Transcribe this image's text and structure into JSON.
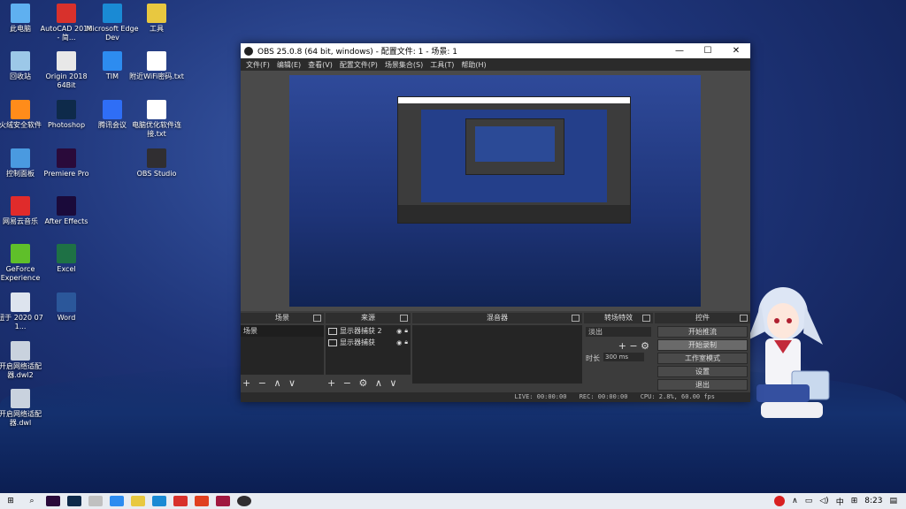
{
  "desktop": {
    "icons": [
      {
        "label": "此电脑",
        "color": "#5fb0f0"
      },
      {
        "label": "回收站",
        "color": "#9cc8e8"
      },
      {
        "label": "火绒安全软件",
        "color": "#ff8c1a"
      },
      {
        "label": "控制面板",
        "color": "#4a9ae0"
      },
      {
        "label": "网易云音乐",
        "color": "#e02b2b"
      },
      {
        "label": "GeForce Experience",
        "color": "#5fbf2a"
      },
      {
        "label": "纽于 2020 07 1...",
        "color": "#dde4ee"
      },
      {
        "label": "开启网络适配器.dwl2",
        "color": "#c9d2de"
      },
      {
        "label": "开启网络适配器.dwl",
        "color": "#c9d2de"
      },
      {
        "label": "AutoCAD 2016 - 简...",
        "color": "#d8312c"
      },
      {
        "label": "Origin 2018 64Bit",
        "color": "#e8e8e8"
      },
      {
        "label": "Photoshop",
        "color": "#0e2a4a"
      },
      {
        "label": "Premiere Pro",
        "color": "#2a0a3a"
      },
      {
        "label": "After Effects",
        "color": "#1a0a3a"
      },
      {
        "label": "Excel",
        "color": "#1e7145"
      },
      {
        "label": "Word",
        "color": "#2b579a"
      },
      {
        "label": "Microsoft Edge Dev",
        "color": "#1a8ad4"
      },
      {
        "label": "TIM",
        "color": "#2d8cf0"
      },
      {
        "label": "腾讯会议",
        "color": "#2f6ef6"
      },
      {
        "label": "工具",
        "color": "#e8c840"
      },
      {
        "label": "附近WiFi密码.txt",
        "color": "#ffffff"
      },
      {
        "label": "电脑优化软件连接.txt",
        "color": "#ffffff"
      },
      {
        "label": "OBS Studio",
        "color": "#302e31"
      }
    ]
  },
  "obs": {
    "title": "OBS 25.0.8 (64 bit, windows) - 配置文件: 1 - 场景: 1",
    "window_buttons": [
      "—",
      "☐",
      "✕"
    ],
    "menu": [
      "文件(F)",
      "编辑(E)",
      "查看(V)",
      "配置文件(P)",
      "场景集合(S)",
      "工具(T)",
      "帮助(H)"
    ],
    "docks": {
      "scenes": {
        "title": "场景",
        "items": [
          "场景"
        ]
      },
      "sources": {
        "title": "来源",
        "items": [
          "显示器捕获 2",
          "显示器捕获"
        ]
      },
      "mixer": {
        "title": "混音器"
      },
      "transitions": {
        "title": "转场特效",
        "select": "淡出",
        "duration_label": "时长",
        "duration_value": "300 ms"
      },
      "controls": {
        "title": "控件",
        "buttons": [
          "开始推流",
          "开始录制",
          "工作室模式",
          "设置",
          "退出"
        ]
      }
    },
    "tool_glyphs": {
      "add": "+",
      "remove": "−",
      "up": "∧",
      "down": "∨",
      "gear": "⚙"
    },
    "status": {
      "live": "LIVE: 00:00:00",
      "rec": "REC: 00:00:00",
      "cpu": "CPU: 2.8%, 60.00 fps"
    }
  },
  "taskbar": {
    "tray_ime": "中",
    "clock": "8:23",
    "tray_arrow": "∧"
  }
}
